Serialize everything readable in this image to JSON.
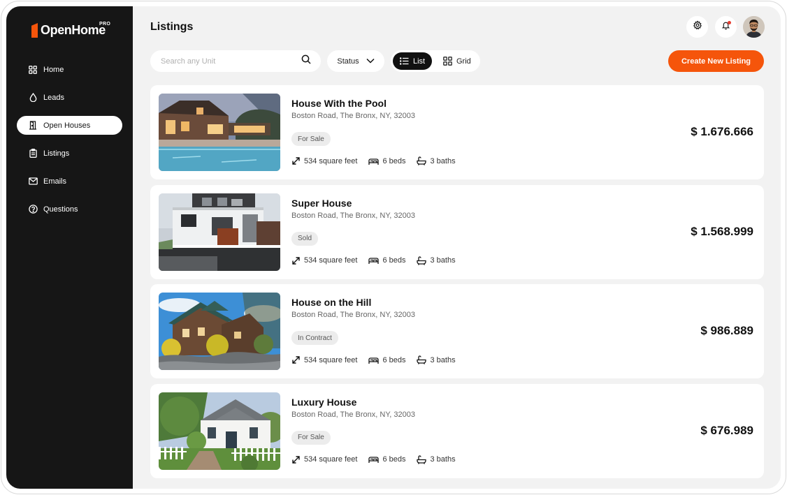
{
  "brand": {
    "name": "OpenHome",
    "tier": "PRO",
    "accent": "#f5550b"
  },
  "sidebar": {
    "items": [
      {
        "label": "Home",
        "icon": "grid-icon",
        "active": false
      },
      {
        "label": "Leads",
        "icon": "droplet-icon",
        "active": false
      },
      {
        "label": "Open Houses",
        "icon": "door-icon",
        "active": true
      },
      {
        "label": "Listings",
        "icon": "clipboard-icon",
        "active": false
      },
      {
        "label": "Emails",
        "icon": "mail-icon",
        "active": false
      },
      {
        "label": "Questions",
        "icon": "help-circle-icon",
        "active": false
      }
    ]
  },
  "header": {
    "title": "Listings",
    "settings_icon": "gear-icon",
    "notifications_icon": "bell-icon",
    "avatar_icon": "user-avatar"
  },
  "toolbar": {
    "search_placeholder": "Search any Unit",
    "status_label": "Status",
    "view_list_label": "List",
    "view_grid_label": "Grid",
    "create_label": "Create New Listing"
  },
  "listings": [
    {
      "title": "House With the Pool",
      "address": "Boston Road, The Bronx, NY, 32003",
      "status": "For Sale",
      "area": "534 square feet",
      "beds": "6 beds",
      "baths": "3 baths",
      "price": "$ 1.676.666"
    },
    {
      "title": "Super House",
      "address": "Boston Road, The Bronx, NY, 32003",
      "status": "Sold",
      "area": "534 square feet",
      "beds": "6 beds",
      "baths": "3 baths",
      "price": "$ 1.568.999"
    },
    {
      "title": "House on the Hill",
      "address": "Boston Road, The Bronx, NY, 32003",
      "status": "In Contract",
      "area": "534 square feet",
      "beds": "6 beds",
      "baths": "3 baths",
      "price": "$ 986.889"
    },
    {
      "title": "Luxury House",
      "address": "Boston Road, The Bronx, NY, 32003",
      "status": "For Sale",
      "area": "534 square feet",
      "beds": "6 beds",
      "baths": "3 baths",
      "price": "$ 676.989"
    }
  ]
}
